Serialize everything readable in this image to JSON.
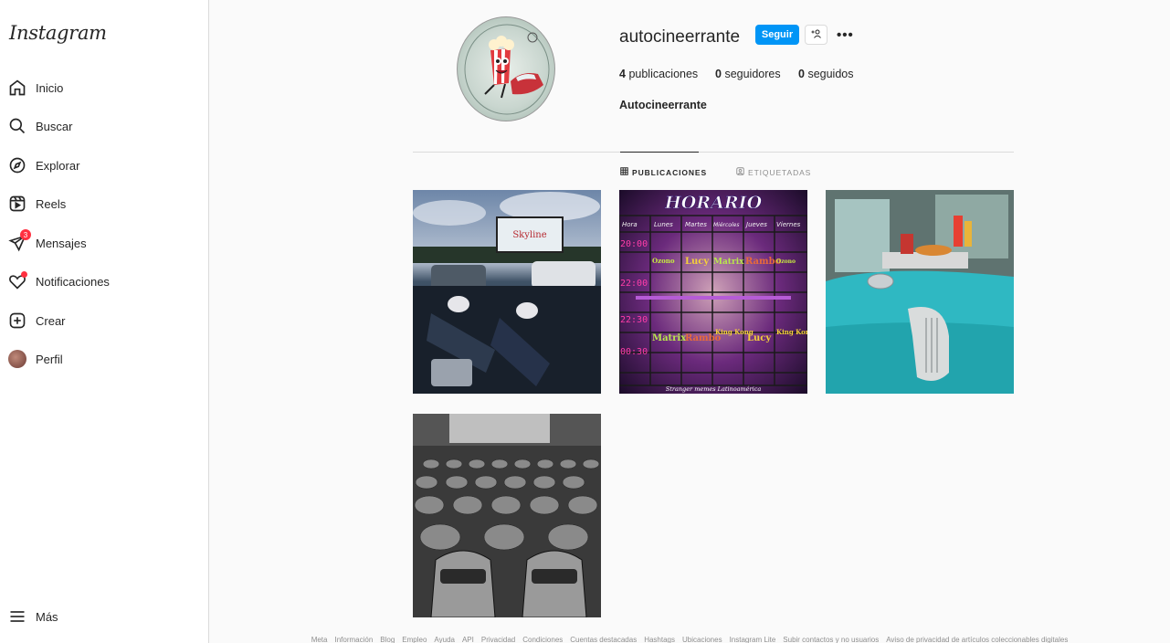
{
  "sidebar": {
    "logo": "Instagram",
    "items": [
      {
        "label": "Inicio",
        "icon": "home-icon"
      },
      {
        "label": "Buscar",
        "icon": "search-icon"
      },
      {
        "label": "Explorar",
        "icon": "compass-icon"
      },
      {
        "label": "Reels",
        "icon": "reels-icon"
      },
      {
        "label": "Mensajes",
        "icon": "messenger-icon",
        "badge": "3"
      },
      {
        "label": "Notificaciones",
        "icon": "heart-icon"
      },
      {
        "label": "Crear",
        "icon": "plus-square-icon"
      },
      {
        "label": "Perfil",
        "icon": "avatar"
      }
    ],
    "more_label": "Más"
  },
  "profile": {
    "username": "autocineerrante",
    "follow_label": "Seguir",
    "suggest_icon": "add-person-icon",
    "more_icon": "more-options-icon",
    "more_text": "•••",
    "stats": {
      "posts_count": "4",
      "posts_label": "publicaciones",
      "followers_count": "0",
      "followers_label": "seguidores",
      "following_count": "0",
      "following_label": "seguidos"
    },
    "full_name": "Autocineerrante"
  },
  "tabs": [
    {
      "label": "PUBLICACIONES",
      "icon": "grid-icon",
      "active": true
    },
    {
      "label": "ETIQUETADAS",
      "icon": "tagged-icon",
      "active": false
    }
  ],
  "posts": {
    "horario": {
      "title": "HORARIO",
      "headers": [
        "Hora",
        "Lunes",
        "Martes",
        "Miércoles",
        "Jueves",
        "Viernes"
      ],
      "times": [
        "20:00",
        "22:00",
        "22:30",
        "00:30"
      ],
      "row1": [
        "Ozono",
        "Lucy",
        "Matrix",
        "Rambo",
        "Ozono"
      ],
      "row2": [
        "Matrix",
        "Rambo",
        "King Kong",
        "Lucy",
        "King Kong"
      ],
      "credit": "Stranger memes Latinoamérica"
    }
  },
  "footer": [
    "Meta",
    "Información",
    "Blog",
    "Empleo",
    "Ayuda",
    "API",
    "Privacidad",
    "Condiciones",
    "Cuentas destacadas",
    "Hashtags",
    "Ubicaciones",
    "Instagram Lite",
    "Subir contactos y no usuarios",
    "Aviso de privacidad de artículos coleccionables digitales"
  ],
  "colors": {
    "accent": "#0095f6",
    "badge": "#ff3040",
    "text": "#262626",
    "muted": "#8e8e8e"
  }
}
